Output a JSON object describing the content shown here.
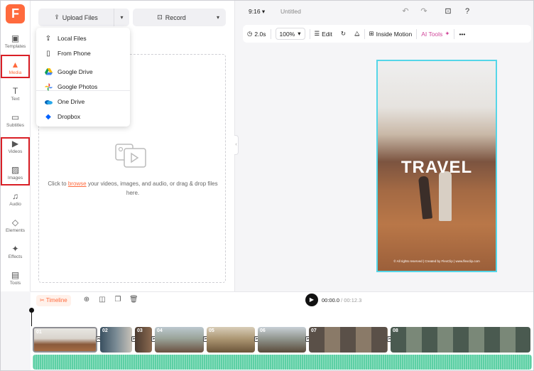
{
  "nav": {
    "logo": "F",
    "items": [
      {
        "label": "Templates",
        "icon": "templates-icon",
        "glyph": "▣"
      },
      {
        "label": "Media",
        "icon": "media-icon",
        "glyph": "▲"
      },
      {
        "label": "Text",
        "icon": "text-icon",
        "glyph": "T"
      },
      {
        "label": "Subtitles",
        "icon": "subtitles-icon",
        "glyph": "▭"
      },
      {
        "label": "Videos",
        "icon": "videos-icon",
        "glyph": "▶"
      },
      {
        "label": "Images",
        "icon": "images-icon",
        "glyph": "▨"
      },
      {
        "label": "Audio",
        "icon": "audio-icon",
        "glyph": "♫"
      },
      {
        "label": "Elements",
        "icon": "elements-icon",
        "glyph": "◇"
      },
      {
        "label": "Effects",
        "icon": "effects-icon",
        "glyph": "✦"
      },
      {
        "label": "Tools",
        "icon": "tools-icon",
        "glyph": "▤"
      }
    ],
    "active": "Media",
    "highlight_color": "#d91f26"
  },
  "panel": {
    "upload_label": "Upload Files",
    "record_label": "Record",
    "dropzone": {
      "prefix": "Click to ",
      "link": "browse",
      "suffix": " your videos, images, and audio, or drag & drop files here."
    }
  },
  "upload_menu": {
    "items": [
      {
        "label": "Local Files",
        "icon": "upload-icon"
      },
      {
        "label": "From Phone",
        "icon": "phone-icon"
      },
      {
        "label": "Google Drive",
        "icon": "google-drive-icon"
      },
      {
        "label": "Google Photos",
        "icon": "google-photos-icon"
      },
      {
        "label": "One Drive",
        "icon": "onedrive-icon"
      },
      {
        "label": "Dropbox",
        "icon": "dropbox-icon"
      }
    ]
  },
  "topbar": {
    "ratio": "9:16",
    "title": "Untitled"
  },
  "toolbar": {
    "duration": "2.0s",
    "zoom": "100%",
    "edit": "Edit",
    "inside_motion": "Inside Motion",
    "ai_tools": "AI Tools"
  },
  "preview": {
    "headline": "TRAVEL",
    "caption": "© All rights reserved | Created by FlexClip | www.flexclip.com",
    "selection_color": "#55d6e8"
  },
  "timeline": {
    "label": "Timeline",
    "current_time": "00:00.0",
    "total_time": "/ 00:12.3",
    "clips": [
      "01",
      "02",
      "03",
      "04",
      "05",
      "06",
      "07",
      "08"
    ],
    "audio_color": "#5cd0a4"
  },
  "accent_color": "#ff6a3d"
}
